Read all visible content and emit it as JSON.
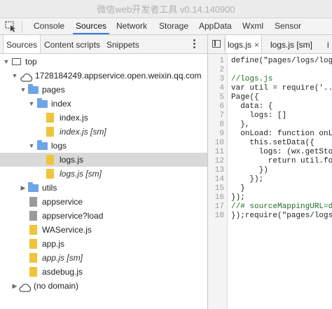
{
  "window": {
    "title": "微信web开发者工具 v0.14.140900"
  },
  "toolbar": {
    "tabs": [
      {
        "label": "Console",
        "active": false
      },
      {
        "label": "Sources",
        "active": true
      },
      {
        "label": "Network",
        "active": false
      },
      {
        "label": "Storage",
        "active": false
      },
      {
        "label": "AppData",
        "active": false
      },
      {
        "label": "Wxml",
        "active": false
      },
      {
        "label": "Sensor",
        "active": false
      }
    ]
  },
  "navigator": {
    "tabs": [
      {
        "label": "Sources",
        "active": true
      },
      {
        "label": "Content scripts",
        "active": false
      },
      {
        "label": "Snippets",
        "active": false
      }
    ],
    "tree": [
      {
        "label": "top",
        "icon": "frame-icon",
        "expanded": true
      },
      {
        "label": "1728184249.appservice.open.weixin.qq.com",
        "icon": "cloud-icon",
        "expanded": true
      },
      {
        "label": "pages",
        "icon": "folder-icon",
        "expanded": true
      },
      {
        "label": "index",
        "icon": "folder-icon",
        "expanded": true
      },
      {
        "label": "index.js",
        "icon": "js-file-icon"
      },
      {
        "label": "index.js [sm]",
        "icon": "js-file-icon",
        "italic": true
      },
      {
        "label": "logs",
        "icon": "folder-icon",
        "expanded": true
      },
      {
        "label": "logs.js",
        "icon": "js-file-icon",
        "selected": true
      },
      {
        "label": "logs.js [sm]",
        "icon": "js-file-icon",
        "italic": true
      },
      {
        "label": "utils",
        "icon": "folder-icon",
        "expanded": false
      },
      {
        "label": "appservice",
        "icon": "document-icon"
      },
      {
        "label": "appservice?load",
        "icon": "document-icon"
      },
      {
        "label": "WAService.js",
        "icon": "js-file-icon"
      },
      {
        "label": "app.js",
        "icon": "js-file-icon"
      },
      {
        "label": "app.js [sm]",
        "icon": "js-file-icon",
        "italic": true
      },
      {
        "label": "asdebug.js",
        "icon": "js-file-icon"
      },
      {
        "label": "(no domain)",
        "icon": "cloud-icon",
        "expanded": false
      }
    ]
  },
  "editor": {
    "tabs": [
      {
        "label": "logs.js",
        "active": true,
        "close": "×"
      },
      {
        "label": "logs.js [sm]",
        "active": false
      },
      {
        "label": "i",
        "active": false
      }
    ],
    "lines": [
      "define(\"pages/logs/log",
      "",
      "//logs.js",
      "var util = require('..",
      "Page({",
      "  data: {",
      "    logs: []",
      "  },",
      "  onLoad: function onL",
      "    this.setData({",
      "      logs: (wx.getSto",
      "        return util.fo",
      "      })",
      "    });",
      "  }",
      "});",
      "//# sourceMappingURL=d",
      "});require(\"pages/logs"
    ],
    "line_numbers": [
      "1",
      "2",
      "3",
      "4",
      "5",
      "6",
      "7",
      "8",
      "9",
      "10",
      "11",
      "12",
      "13",
      "14",
      "15",
      "16",
      "17",
      "18"
    ]
  }
}
